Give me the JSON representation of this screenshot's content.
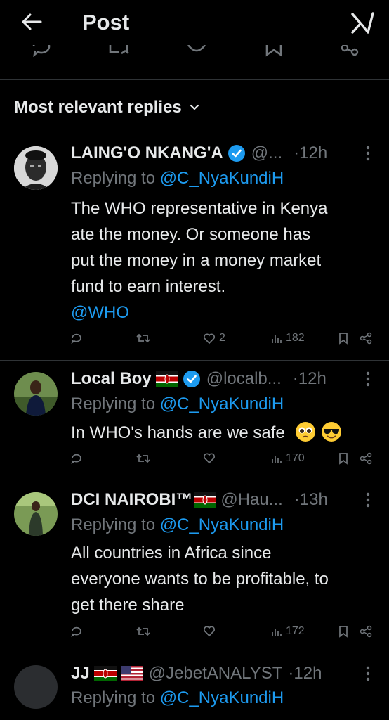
{
  "header": {
    "title": "Post"
  },
  "sort": {
    "label": "Most relevant replies"
  },
  "replies": [
    {
      "display_name": "LAING'O NKANG'A",
      "handle": "@...",
      "time": "12h",
      "replying_prefix": "Replying to",
      "replying_to": "@C_NyaKundiH",
      "body_lines": [
        "The WHO representative in Kenya",
        "ate the money. Or someone has",
        "put the money in a money market",
        "fund to earn interest."
      ],
      "mention_line": "@WHO",
      "likes": "2",
      "views": "182",
      "verified": true
    },
    {
      "display_name": "Local Boy",
      "handle": "@localb...",
      "time": "12h",
      "replying_prefix": "Replying to",
      "replying_to": "@C_NyaKundiH",
      "body_lines": [
        "In WHO's hands are we safe"
      ],
      "likes": "",
      "views": "170",
      "verified": true
    },
    {
      "display_name": "DCI NAIROBI™",
      "handle": "@Hau...",
      "time": "13h",
      "replying_prefix": "Replying to",
      "replying_to": "@C_NyaKundiH",
      "body_lines": [
        "All countries in Africa since",
        "everyone wants to be profitable, to",
        "get there share"
      ],
      "likes": "",
      "views": "172",
      "verified": false
    },
    {
      "display_name": "JJ",
      "handle": "@JebetANALYST",
      "time": "12h",
      "replying_prefix": "Replying to",
      "replying_to": "@C_NyaKundiH",
      "verified": false
    }
  ],
  "colors": {
    "background": "#000000",
    "text": "#e7e9ea",
    "muted": "#71767b",
    "accent": "#1d9bf0",
    "divider": "#2f3336"
  }
}
